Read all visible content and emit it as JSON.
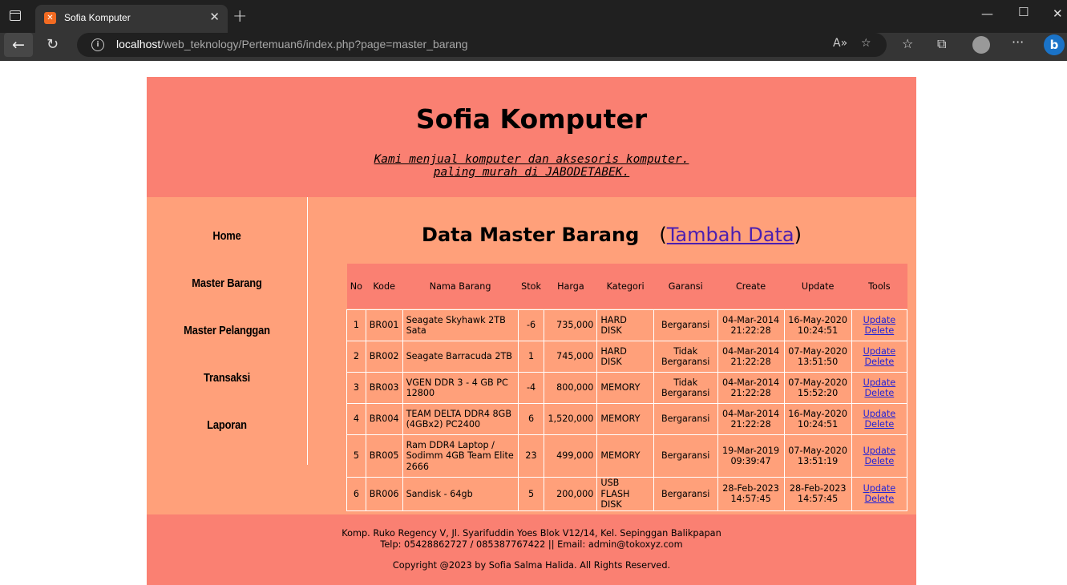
{
  "browser": {
    "tab_title": "Sofia Komputer",
    "url_host": "localhost",
    "url_path": "/web_teknology/Pertemuan6/index.php?page=master_barang"
  },
  "header": {
    "title": "Sofia Komputer",
    "tagline_line1": "Kami menjual komputer dan aksesoris komputer.",
    "tagline_line2": "paling murah di JABODETABEK."
  },
  "nav": {
    "items": [
      "Home",
      "Master Barang",
      "Master Pelanggan",
      "Transaksi",
      "Laporan"
    ]
  },
  "content": {
    "title": "Data Master Barang",
    "add_link": "Tambah Data",
    "open_paren": "(",
    "close_paren": ")"
  },
  "table": {
    "headers": [
      "No",
      "Kode",
      "Nama Barang",
      "Stok",
      "Harga",
      "Kategori",
      "Garansi",
      "Create",
      "Update",
      "Tools"
    ],
    "rows": [
      {
        "no": "1",
        "kode": "BR001",
        "nama_1": "Seagate Skyhawk 2TB",
        "nama_2": "Sata",
        "nama_3": "",
        "stok": "-6",
        "harga": "735,000",
        "kat_1": "HARD DISK",
        "kat_2": "",
        "gar_1": "Bergaransi",
        "gar_2": "",
        "create_date": "04-Mar-2014",
        "create_time": "21:22:28",
        "update_date": "16-May-2020",
        "update_time": "10:24:51",
        "update_link": "Update",
        "delete_link": "Delete"
      },
      {
        "no": "2",
        "kode": "BR002",
        "nama_1": "Seagate Barracuda 2TB",
        "nama_2": "",
        "nama_3": "",
        "stok": "1",
        "harga": "745,000",
        "kat_1": "HARD DISK",
        "kat_2": "",
        "gar_1": "Tidak",
        "gar_2": "Bergaransi",
        "create_date": "04-Mar-2014",
        "create_time": "21:22:28",
        "update_date": "07-May-2020",
        "update_time": "13:51:50",
        "update_link": "Update",
        "delete_link": "Delete"
      },
      {
        "no": "3",
        "kode": "BR003",
        "nama_1": "VGEN DDR 3 - 4 GB PC",
        "nama_2": "12800",
        "nama_3": "",
        "stok": "-4",
        "harga": "800,000",
        "kat_1": "MEMORY",
        "kat_2": "",
        "gar_1": "Tidak",
        "gar_2": "Bergaransi",
        "create_date": "04-Mar-2014",
        "create_time": "21:22:28",
        "update_date": "07-May-2020",
        "update_time": "15:52:20",
        "update_link": "Update",
        "delete_link": "Delete"
      },
      {
        "no": "4",
        "kode": "BR004",
        "nama_1": "TEAM DELTA DDR4 8GB",
        "nama_2": "(4GBx2) PC2400",
        "nama_3": "",
        "stok": "6",
        "harga": "1,520,000",
        "kat_1": "MEMORY",
        "kat_2": "",
        "gar_1": "Bergaransi",
        "gar_2": "",
        "create_date": "04-Mar-2014",
        "create_time": "21:22:28",
        "update_date": "16-May-2020",
        "update_time": "10:24:51",
        "update_link": "Update",
        "delete_link": "Delete"
      },
      {
        "no": "5",
        "kode": "BR005",
        "nama_1": "Ram DDR4 Laptop /",
        "nama_2": "Sodimm 4GB Team Elite",
        "nama_3": "2666",
        "stok": "23",
        "harga": "499,000",
        "kat_1": "MEMORY",
        "kat_2": "",
        "gar_1": "Bergaransi",
        "gar_2": "",
        "create_date": "19-Mar-2019",
        "create_time": "09:39:47",
        "update_date": "07-May-2020",
        "update_time": "13:51:19",
        "update_link": "Update",
        "delete_link": "Delete"
      },
      {
        "no": "6",
        "kode": "BR006",
        "nama_1": "Sandisk - 64gb",
        "nama_2": "",
        "nama_3": "",
        "stok": "5",
        "harga": "200,000",
        "kat_1": "USB FLASH",
        "kat_2": "DISK",
        "gar_1": "Bergaransi",
        "gar_2": "",
        "create_date": "28-Feb-2023",
        "create_time": "14:57:45",
        "update_date": "28-Feb-2023",
        "update_time": "14:57:45",
        "update_link": "Update",
        "delete_link": "Delete"
      }
    ]
  },
  "footer": {
    "address": "Komp. Ruko Regency V, Jl. Syarifuddin Yoes Blok V12/14, Kel. Sepinggan Balikpapan",
    "contact": "Telp: 05428862727 / 085387767422 || Email: admin@tokoxyz.com",
    "copyright": "Copyright @2023 by Sofia Salma Halida. All Rights Reserved."
  },
  "colors": {
    "header_bg": "#fa8072",
    "body_bg": "#ffa07a",
    "link": "#2323d8",
    "chrome_dark": "#202020",
    "chrome_toolbar": "#353535"
  }
}
